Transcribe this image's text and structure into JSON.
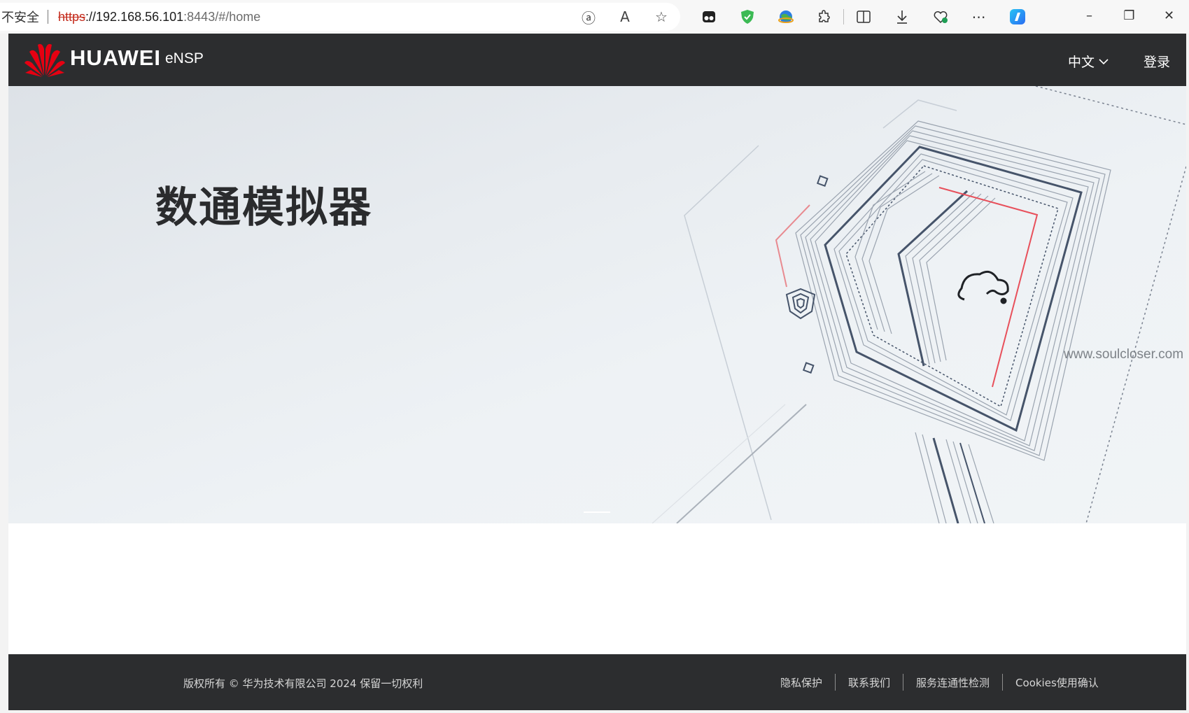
{
  "browser": {
    "insecure_label": "不安全",
    "url_scheme": "https",
    "url_host": "://192.168.56.101",
    "url_rest": ":8443/#/home"
  },
  "header": {
    "brand": "HUAWEI",
    "product": "eNSP",
    "language": "中文",
    "login": "登录"
  },
  "hero": {
    "title": "数通模拟器",
    "watermark": "www.soulcloser.com"
  },
  "footer": {
    "copyright": "版权所有 © 华为技术有限公司 2024 保留一切权利",
    "links": [
      "隐私保护",
      "联系我们",
      "服务连通性检测",
      "Cookies使用确认"
    ]
  },
  "colors": {
    "header_bg": "#2c2d2f",
    "brand_red": "#e60012",
    "accent_red": "#e8505b",
    "line_blue": "#46546a"
  }
}
